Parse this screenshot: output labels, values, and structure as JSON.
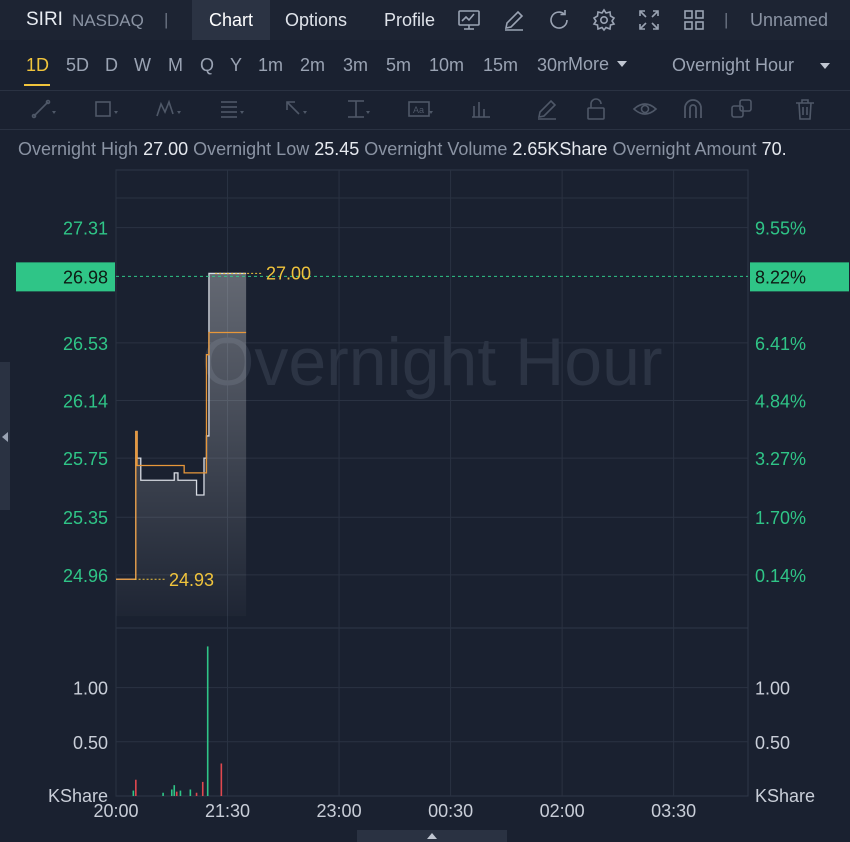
{
  "header": {
    "symbol": "SIRI",
    "exchange": "NASDAQ",
    "separator": "|",
    "tabs": [
      {
        "label": "Chart",
        "active": true
      },
      {
        "label": "Options",
        "active": false
      },
      {
        "label": "Profile",
        "active": false
      }
    ],
    "toolbar_icons": [
      "chart-settings-icon",
      "edit-icon",
      "refresh-icon",
      "gear-icon",
      "fullscreen-icon",
      "layout-grid-icon"
    ],
    "layout_name": "Unnamed"
  },
  "periods": {
    "items": [
      "1D",
      "5D",
      "D",
      "W",
      "M",
      "Q",
      "Y",
      "1m",
      "2m",
      "3m",
      "5m",
      "10m",
      "15m",
      "30m"
    ],
    "selected": "1D",
    "more_label": "More",
    "session_label": "Overnight Hour"
  },
  "drawing_tools": [
    "line-tool-icon",
    "rectangle-tool-icon",
    "pattern-tool-icon",
    "fibonacci-tool-icon",
    "arrow-tool-icon",
    "measure-tool-icon",
    "text-tool-icon",
    "indicator-tool-icon",
    "pencil-icon",
    "lock-icon",
    "eye-icon",
    "magnet-icon",
    "clone-icon",
    "trash-icon"
  ],
  "stats": [
    {
      "label": "Overnight High",
      "value": "27.00"
    },
    {
      "label": "Overnight Low",
      "value": "25.45"
    },
    {
      "label": "Overnight Volume",
      "value": "2.65KShare"
    },
    {
      "label": "Overnight Amount",
      "value": "70."
    }
  ],
  "chart": {
    "watermark": "Overnight Hour",
    "current_price": "26.98",
    "current_pct": "8.22%",
    "high_marker": "27.00",
    "low_marker": "24.93",
    "volume_unit": "KShare",
    "colors": {
      "up": "#2fc587",
      "down": "#e0484f",
      "price_line": "#d7dbe3",
      "avg_line": "#e7973a",
      "marker_text": "#f0c43c"
    }
  },
  "chart_data": {
    "type": "line",
    "price_ticks": [
      "27.31",
      "26.53",
      "26.14",
      "25.75",
      "25.35",
      "24.96"
    ],
    "pct_ticks": [
      "9.55%",
      "6.41%",
      "4.84%",
      "3.27%",
      "1.70%",
      "0.14%"
    ],
    "x_ticks": [
      "20:00",
      "21:30",
      "23:00",
      "00:30",
      "02:00",
      "03:30"
    ],
    "volume_ticks": [
      "1.00",
      "0.50"
    ],
    "ylim": [
      24.6,
      27.7
    ],
    "price_series": {
      "x": [
        "20:00",
        "20:15",
        "20:16",
        "20:17",
        "20:20",
        "20:45",
        "20:47",
        "20:50",
        "21:00",
        "21:05",
        "21:10",
        "21:11",
        "21:13",
        "21:15",
        "21:20",
        "21:30",
        "21:45"
      ],
      "values": [
        24.93,
        24.93,
        25.93,
        25.75,
        25.6,
        25.6,
        25.65,
        25.6,
        25.6,
        25.5,
        25.5,
        25.75,
        25.9,
        27.0,
        27.0,
        27.0,
        27.0
      ]
    },
    "avg_series": {
      "x": [
        "20:00",
        "20:15",
        "20:16",
        "20:17",
        "20:50",
        "20:55",
        "21:10",
        "21:12",
        "21:13",
        "21:15",
        "21:30",
        "21:45"
      ],
      "values": [
        24.93,
        24.93,
        25.93,
        25.7,
        25.7,
        25.65,
        25.65,
        25.65,
        26.45,
        26.6,
        26.6,
        26.6
      ]
    },
    "volume": [
      {
        "x": "20:14",
        "v": 0.05,
        "dir": "up"
      },
      {
        "x": "20:16",
        "v": 0.15,
        "dir": "down"
      },
      {
        "x": "20:38",
        "v": 0.03,
        "dir": "up"
      },
      {
        "x": "20:45",
        "v": 0.06,
        "dir": "up"
      },
      {
        "x": "20:47",
        "v": 0.1,
        "dir": "up"
      },
      {
        "x": "20:49",
        "v": 0.04,
        "dir": "down"
      },
      {
        "x": "20:52",
        "v": 0.05,
        "dir": "up"
      },
      {
        "x": "21:00",
        "v": 0.06,
        "dir": "up"
      },
      {
        "x": "21:05",
        "v": 0.03,
        "dir": "down"
      },
      {
        "x": "21:10",
        "v": 0.13,
        "dir": "down"
      },
      {
        "x": "21:14",
        "v": 1.38,
        "dir": "up"
      },
      {
        "x": "21:25",
        "v": 0.3,
        "dir": "down"
      }
    ]
  }
}
